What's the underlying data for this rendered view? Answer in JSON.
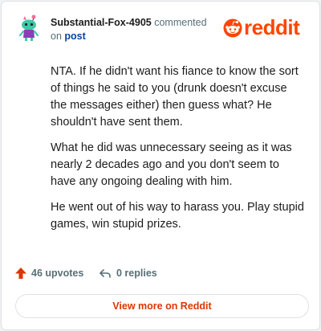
{
  "comment": {
    "author": "Substantial-Fox-4905",
    "action_text": "commented",
    "on_text": "on",
    "post_link": "post",
    "paragraphs": [
      "NTA. If he didn't want his fiance to know the sort of things he said to you (drunk doesn't excuse the messages either) then guess what? He shouldn't have sent them.",
      "What he did was unnecessary seeing as it was nearly 2 decades ago and you don't seem to have any ongoing dealing with him.",
      "He went out of his way to harass you. Play stupid games, win stupid prizes."
    ],
    "upvotes_label": "46 upvotes",
    "replies_label": "0 replies"
  },
  "branding": {
    "logo_text": "reddit",
    "icon": "reddit-snoo-icon"
  },
  "footer": {
    "view_more_label": "View more on Reddit"
  },
  "colors": {
    "brand": "#ff4500",
    "link": "#0a449b",
    "upvote": "#d93900",
    "meta": "#576f76"
  }
}
